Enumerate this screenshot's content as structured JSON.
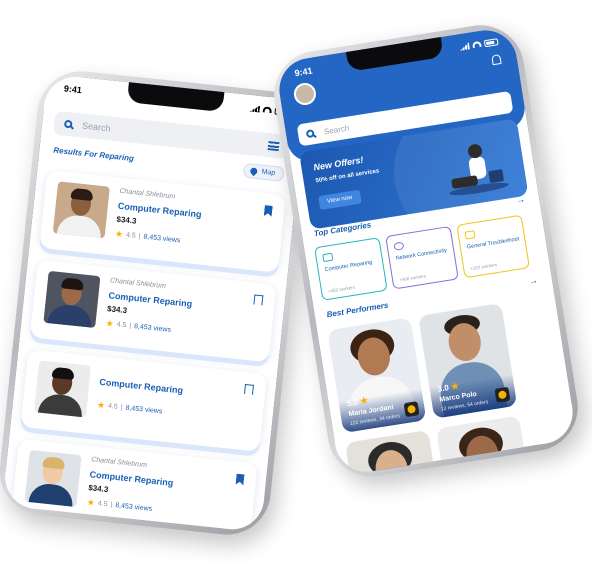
{
  "left_phone": {
    "status_time": "9:41",
    "search_placeholder": "Search",
    "results_title": "Results For Reparing",
    "map_label": "Map",
    "cards": [
      {
        "owner": "Chantal Shlebrum",
        "service": "Computer Reparing",
        "price": "$34.3",
        "rating": "4.5",
        "views": "8,453 views",
        "bookmarked": true
      },
      {
        "owner": "Chantal Shlebrum",
        "service": "Computer Reparing",
        "price": "$34.3",
        "rating": "4.5",
        "views": "8,453 views",
        "bookmarked": false
      },
      {
        "owner": "",
        "service": "Computer Reparing",
        "price": "",
        "rating": "4.5",
        "views": "8,453 views",
        "bookmarked": false
      },
      {
        "owner": "Chantal Shlebrum",
        "service": "Computer Reparing",
        "price": "$34.3",
        "rating": "4.5",
        "views": "8,453 views",
        "bookmarked": true
      }
    ]
  },
  "right_phone": {
    "status_time": "9:41",
    "search_placeholder": "Search",
    "offer": {
      "title": "New Offers!",
      "subtitle": "50% off on all services",
      "button": "View now"
    },
    "top_categories_title": "Top Categories",
    "categories": [
      {
        "label": "Computer Reparing",
        "workers": "+450 workers",
        "color": "#2bb3c6"
      },
      {
        "label": "Network Connectivity",
        "workers": "+400 workers",
        "color": "#7f73d6"
      },
      {
        "label": "General Troubleshoot",
        "workers": "+152 workers",
        "color": "#f0c419"
      }
    ],
    "best_performers_title": "Best Performers",
    "performers": [
      {
        "name": "Maria Jordani",
        "rating": "5.0",
        "stats": "122 reviews, 34 orders"
      },
      {
        "name": "Marco Polo",
        "rating": "3.0",
        "stats": "12 reviews, 54 orders"
      }
    ]
  },
  "colors": {
    "accent": "#1a5fb4",
    "header": "#2366c4",
    "star": "#f5b400"
  }
}
